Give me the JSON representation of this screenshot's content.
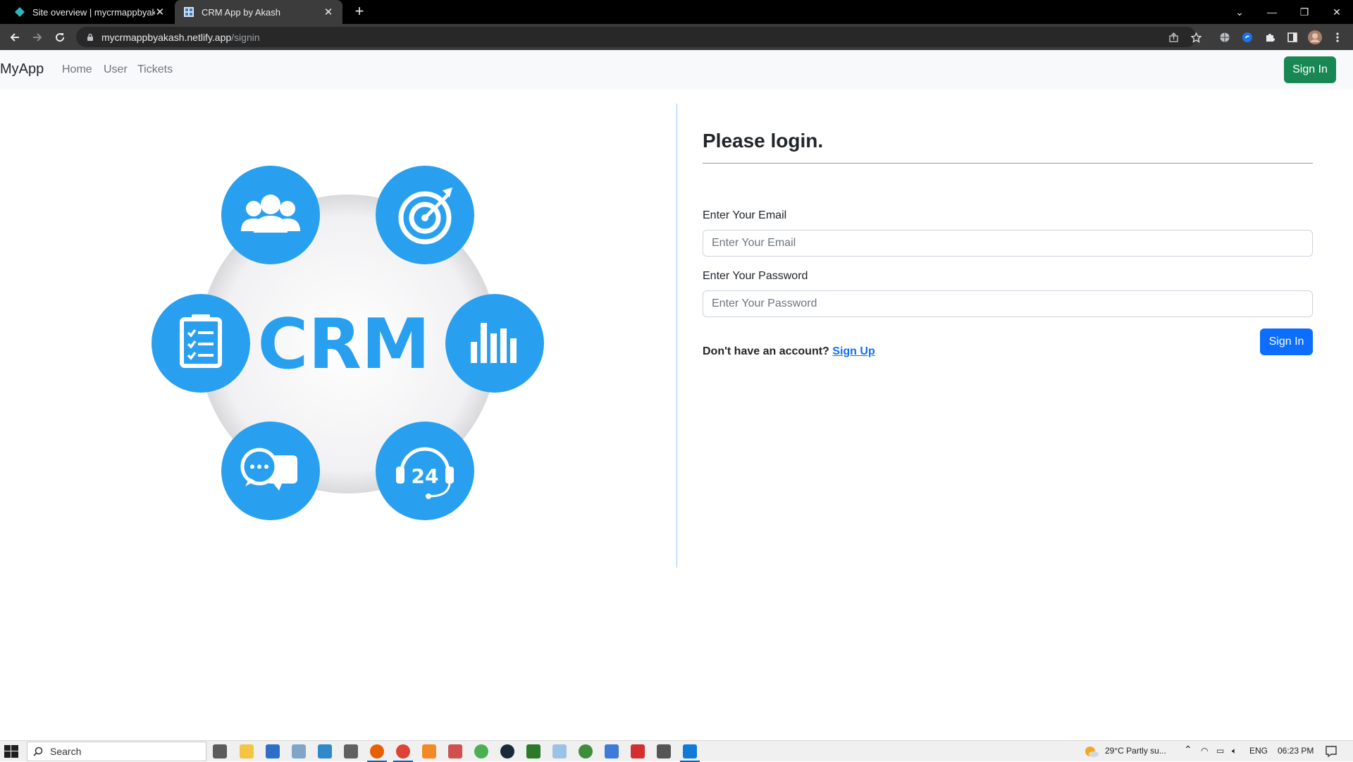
{
  "browser": {
    "tabs": [
      {
        "title": "Site overview | mycrmappbyakash",
        "active": false
      },
      {
        "title": "CRM App by Akash",
        "active": true
      }
    ],
    "url_host": "mycrmappbyakash.netlify.app",
    "url_path": "/signin"
  },
  "navbar": {
    "brand": "MyApp",
    "links": [
      "Home",
      "User",
      "Tickets"
    ],
    "signin_label": "Sign In"
  },
  "illustration": {
    "text": "CRM",
    "badge_text": "24",
    "circle_color": "#28a0ef",
    "icons": [
      "group-icon",
      "target-icon",
      "clipboard-checklist-icon",
      "bar-chart-icon",
      "chat-bubbles-icon",
      "headset-24-icon"
    ]
  },
  "login": {
    "heading": "Please login.",
    "email_label": "Enter Your Email",
    "email_placeholder": "Enter Your Email",
    "password_label": "Enter Your Password",
    "password_placeholder": "Enter Your Password",
    "submit_label": "Sign In",
    "signup_prompt": "Don't have an account?",
    "signup_link": "Sign Up"
  },
  "taskbar": {
    "search_placeholder": "Search",
    "weather": "29°C  Partly su...",
    "language": "ENG",
    "time": "06:23 PM"
  },
  "colors": {
    "primary": "#0d6efd",
    "success": "#198754",
    "crm_blue": "#28a0ef"
  }
}
